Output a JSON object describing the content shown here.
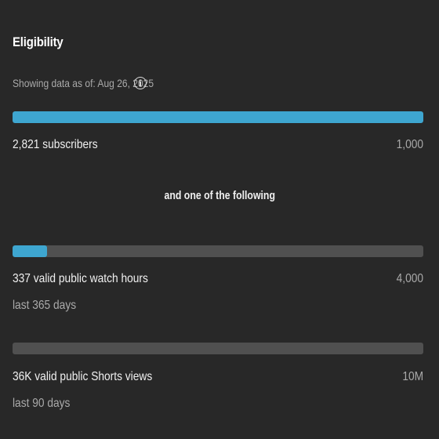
{
  "title": "Eligibility",
  "as_of": "Showing data as of: Aug 26, 2025",
  "info_icon": "info-icon",
  "colors": {
    "background": "#282828",
    "fill": "#3ea6d0",
    "track": "#505050"
  },
  "connector": "and one of the following",
  "requirements": [
    {
      "label": "2,821 subscribers",
      "target": "1,000",
      "period": "",
      "progress": 1.0
    },
    {
      "label": "337 valid public watch hours",
      "target": "4,000",
      "period": "last 365 days",
      "progress": 0.0843
    },
    {
      "label": "36K valid public Shorts views",
      "target": "10M",
      "period": "last 90 days",
      "progress": 0.0036
    }
  ]
}
